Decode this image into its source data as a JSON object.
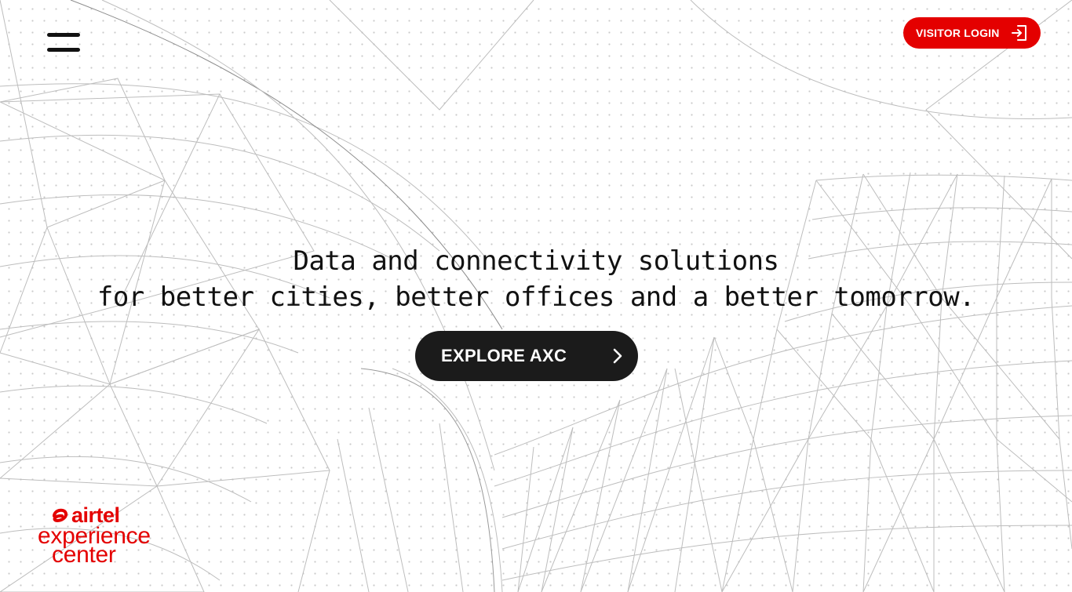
{
  "header": {
    "menu_icon": "hamburger-menu-icon",
    "visitor_login_label": "VISITOR LOGIN",
    "login_icon": "login-arrow-icon"
  },
  "hero": {
    "line1": "Data and connectivity solutions",
    "line2": "for better cities, better offices and a better tomorrow.",
    "explore_label": "EXPLORE AXC",
    "explore_icon": "chevron-right-icon"
  },
  "logo": {
    "brand": "airtel",
    "line2": "experience",
    "line3": "center"
  },
  "colors": {
    "accent": "#e40000",
    "dark_button": "#1b1b1b",
    "text": "#111111",
    "background": "#ffffff"
  }
}
